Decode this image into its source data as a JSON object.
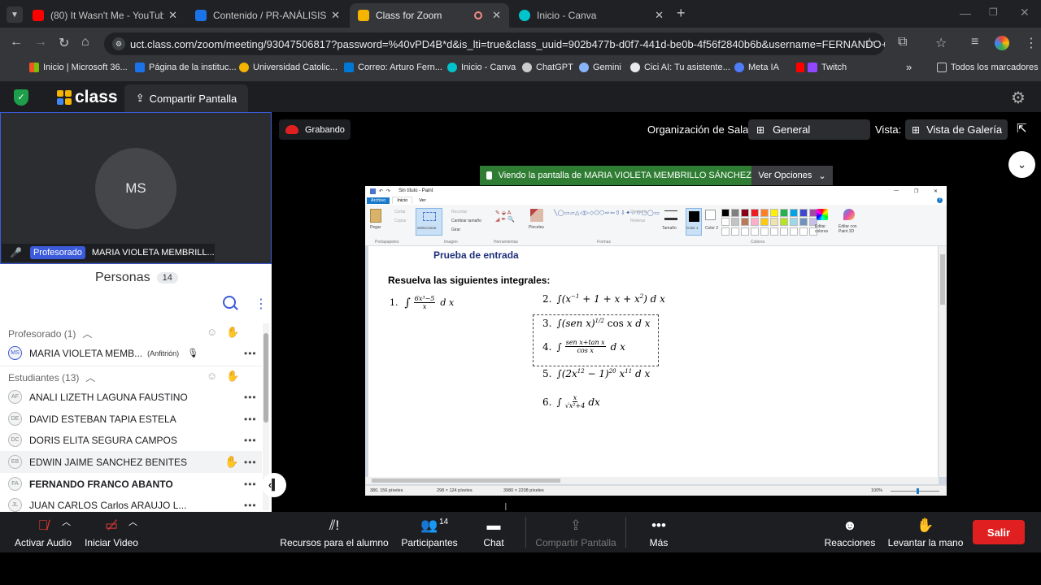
{
  "browser": {
    "tabs": [
      {
        "title": "(80) It Wasn't Me - YouTube",
        "color": "#ff0000"
      },
      {
        "title": "Contenido / PR-ANÁLISIS MATE",
        "color": "#1a73e8"
      },
      {
        "title": "Class for Zoom",
        "color": "#f4b400"
      },
      {
        "title": "Inicio - Canva",
        "color": "#00c4cc"
      }
    ],
    "url": "uct.class.com/zoom/meeting/93047506817?password=%40vPD4B*d&is_lti=true&class_uuid=902b477b-d0f7-441d-be0b-4f56f2840b6b&username=FERNANDO+FRANCO...",
    "bookmarks": [
      "Inicio | Microsoft 36...",
      "Página de la instituc...",
      "Universidad Catolic...",
      "Correo: Arturo Fern...",
      "Inicio - Canva",
      "ChatGPT",
      "Gemini",
      "Cici AI: Tu asistente...",
      "Meta IA",
      "Twitch"
    ],
    "all_bookmarks": "Todos los marcadores"
  },
  "app": {
    "logo": "class",
    "share_screen": "Compartir Pantalla",
    "recording": "Grabando",
    "room_org_label": "Organización de Sala:",
    "room_org_value": "General",
    "view_label": "Vista:",
    "view_value": "Vista de Galería",
    "viewing_banner": "Viendo la pantalla de MARIA VIOLETA MEMBRILLO SÁNCHEZ",
    "view_options": "Ver Opciones"
  },
  "presenter": {
    "initials": "MS",
    "role": "Profesorado",
    "name": "MARIA VIOLETA MEMBRILL..."
  },
  "people": {
    "title": "Personas",
    "count": "14",
    "teachers_header": "Profesorado (1)",
    "teacher": {
      "initials": "MS",
      "name": "MARIA VIOLETA MEMB...",
      "tag": "(Anfitrión)"
    },
    "students_header": "Estudiantes (13)",
    "students": [
      {
        "initials": "AF",
        "name": "ANALI LIZETH LAGUNA FAUSTINO"
      },
      {
        "initials": "DE",
        "name": "DAVID ESTEBAN TAPIA ESTELA"
      },
      {
        "initials": "DC",
        "name": "DORIS ELITA SEGURA CAMPOS"
      },
      {
        "initials": "EB",
        "name": "EDWIN JAIME SANCHEZ BENITES"
      },
      {
        "initials": "FA",
        "name": "FERNANDO FRANCO ABANTO"
      },
      {
        "initials": "JL",
        "name": "JUAN CARLOS Carlos ARAUJO L..."
      }
    ]
  },
  "paint": {
    "title": "Sin título - Paint",
    "menu": [
      "Archivo",
      "Inicio",
      "Ver"
    ],
    "groups": [
      "Portapapeles",
      "Imagen",
      "Herramientas",
      "Formas",
      "Colores"
    ],
    "tools": {
      "paste": "Pegar",
      "cut": "Cortar",
      "copy": "Copiar",
      "select": "Seleccionar",
      "crop": "Recortar",
      "resize": "Cambiar tamaño",
      "rotate": "Girar",
      "brushes": "Pinceles",
      "outline": "Contorno",
      "fill": "Rellenar",
      "size": "Tamaño",
      "color1": "Color 1",
      "color2": "Color 2",
      "edit_colors": "Editar colores",
      "paint3d": "Editar con Paint 3D"
    },
    "status": {
      "pos": "380, 156 píxeles",
      "sel": "298 × 124 píxeles",
      "size": "3980 × 2208 píxeles",
      "zoom": "100%"
    },
    "doc": {
      "title": "Prueba de entrada",
      "subtitle": "Resuelva las siguientes integrales:",
      "n1": "1.",
      "n2": "2.",
      "n3": "3.",
      "n4": "4.",
      "n5": "5.",
      "n6": "6."
    }
  },
  "toolbar": {
    "audio": "Activar Audio",
    "video": "Iniciar Video",
    "resources": "Recursos para el alumno",
    "participants": "Participantes",
    "participants_count": "14",
    "chat": "Chat",
    "share": "Compartir Pantalla",
    "more": "Más",
    "reactions": "Reacciones",
    "raise_hand": "Levantar la mano",
    "exit": "Salir"
  },
  "colors": {
    "exit": "#e02020",
    "banner": "#2e7d32",
    "accent": "#3b5bdb"
  }
}
